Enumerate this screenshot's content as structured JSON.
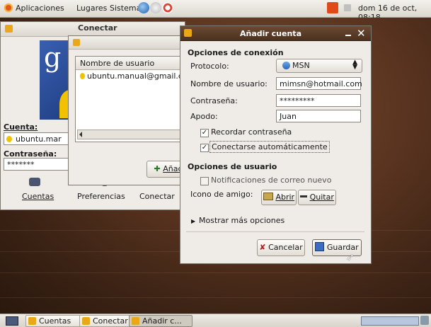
{
  "top_panel": {
    "menus": [
      "Aplicaciones",
      "Lugares",
      "Sistema"
    ],
    "clock": "dom 16 de oct, 08:18"
  },
  "buddy_window": {
    "account_label": "Cuenta:",
    "account_value": "ubuntu.mar",
    "password_label": "Contraseña:",
    "password_value": "*******",
    "buttons": {
      "accounts": "Cuentas",
      "preferences": "Preferencias",
      "connect": "Conectar"
    }
  },
  "connect_window": {
    "title": "Conectar",
    "column_header": "Nombre de usuario",
    "rows": [
      "ubuntu.manual@gmail.com"
    ],
    "add_button": "Añad"
  },
  "add_account_dialog": {
    "title": "Añadir cuenta",
    "connection_options_heading": "Opciones de conexión",
    "protocol_label": "Protocolo:",
    "protocol_value": "MSN",
    "username_label": "Nombre de usuario:",
    "username_value": "mimsn@hotmail.com",
    "password_label": "Contraseña:",
    "password_value": "*********",
    "alias_label": "Apodo:",
    "alias_value": "Juan",
    "remember_password": "Recordar contraseña",
    "auto_connect": "Conectarse automáticamente",
    "user_options_heading": "Opciones de usuario",
    "mail_notifications": "Notificaciones de correo nuevo",
    "buddy_icon_label": "Icono de amigo:",
    "open_button": "Abrir",
    "remove_button": "Quitar",
    "more_options": "Mostrar más opciones",
    "cancel_button": "Cancelar",
    "save_button": "Guardar"
  },
  "taskbar": {
    "items": [
      "Cuentas",
      "Conectar",
      "Añadir c..."
    ]
  }
}
